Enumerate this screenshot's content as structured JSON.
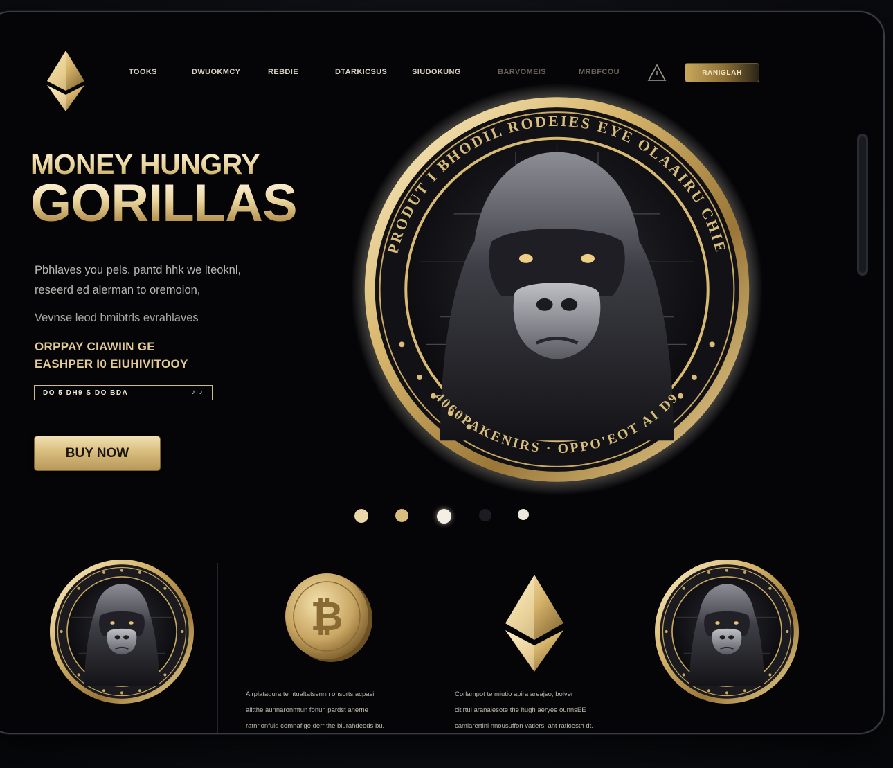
{
  "nav": {
    "items": [
      "TOOKS",
      "DWUOKMCY",
      "REBDIE",
      "DTARKICSUS",
      "SIUDOKUNG",
      "BARVOMEIS",
      "MRBFCOU"
    ],
    "login_label": "RANIGLAH"
  },
  "hero": {
    "title_line1": "MONEY HUNGRY",
    "title_line2": "GORILLAS",
    "description_line1": "Pbhlaves you pels. pantd hhk we lteoknl,",
    "description_line2": "reseerd ed alerman to oremoion,",
    "subtext": "Vevnse leod bmibtrls evrahlaves",
    "highlight_line1": "ORPPAY CIAWIIN GE",
    "highlight_line2": "EASHPER I0 EIUHIVITOOY",
    "input_value": "DO 5  DH9  S DO BDA",
    "input_icons": "♪ ♪",
    "buy_label": "BUY NOW",
    "coin_ring_top": "PRODUT I BHODIL RODEIES EYE OLAAIRU CHIE",
    "coin_ring_bottom": "4060PAKENIRS · OPPO'EOT AI D9"
  },
  "carousel": {
    "active_index": 2,
    "count": 5
  },
  "features": [
    {
      "type": "gorilla-coin",
      "caption": []
    },
    {
      "type": "bitcoin-coin",
      "caption": [
        "Alrplatagura te ntualtatsennn onsorts acpasi",
        "alltthe aunnaronmtun fonun pardst anerne",
        "ratnrionfuld comnafige derr the blurahdeeds bu."
      ]
    },
    {
      "type": "ethereum-logo",
      "caption": [
        "Corlampot te miutio apira areajso, bolver",
        "citirtul aranalesote the hugh aeryee ounnsEE",
        "camiarertinl nnousuffon vatiers. aht ratioesth dt."
      ]
    },
    {
      "type": "gorilla-coin",
      "caption": []
    }
  ],
  "colors": {
    "gold": "#d8bd7d",
    "gold_light": "#f2e1b3",
    "background": "#050507"
  }
}
